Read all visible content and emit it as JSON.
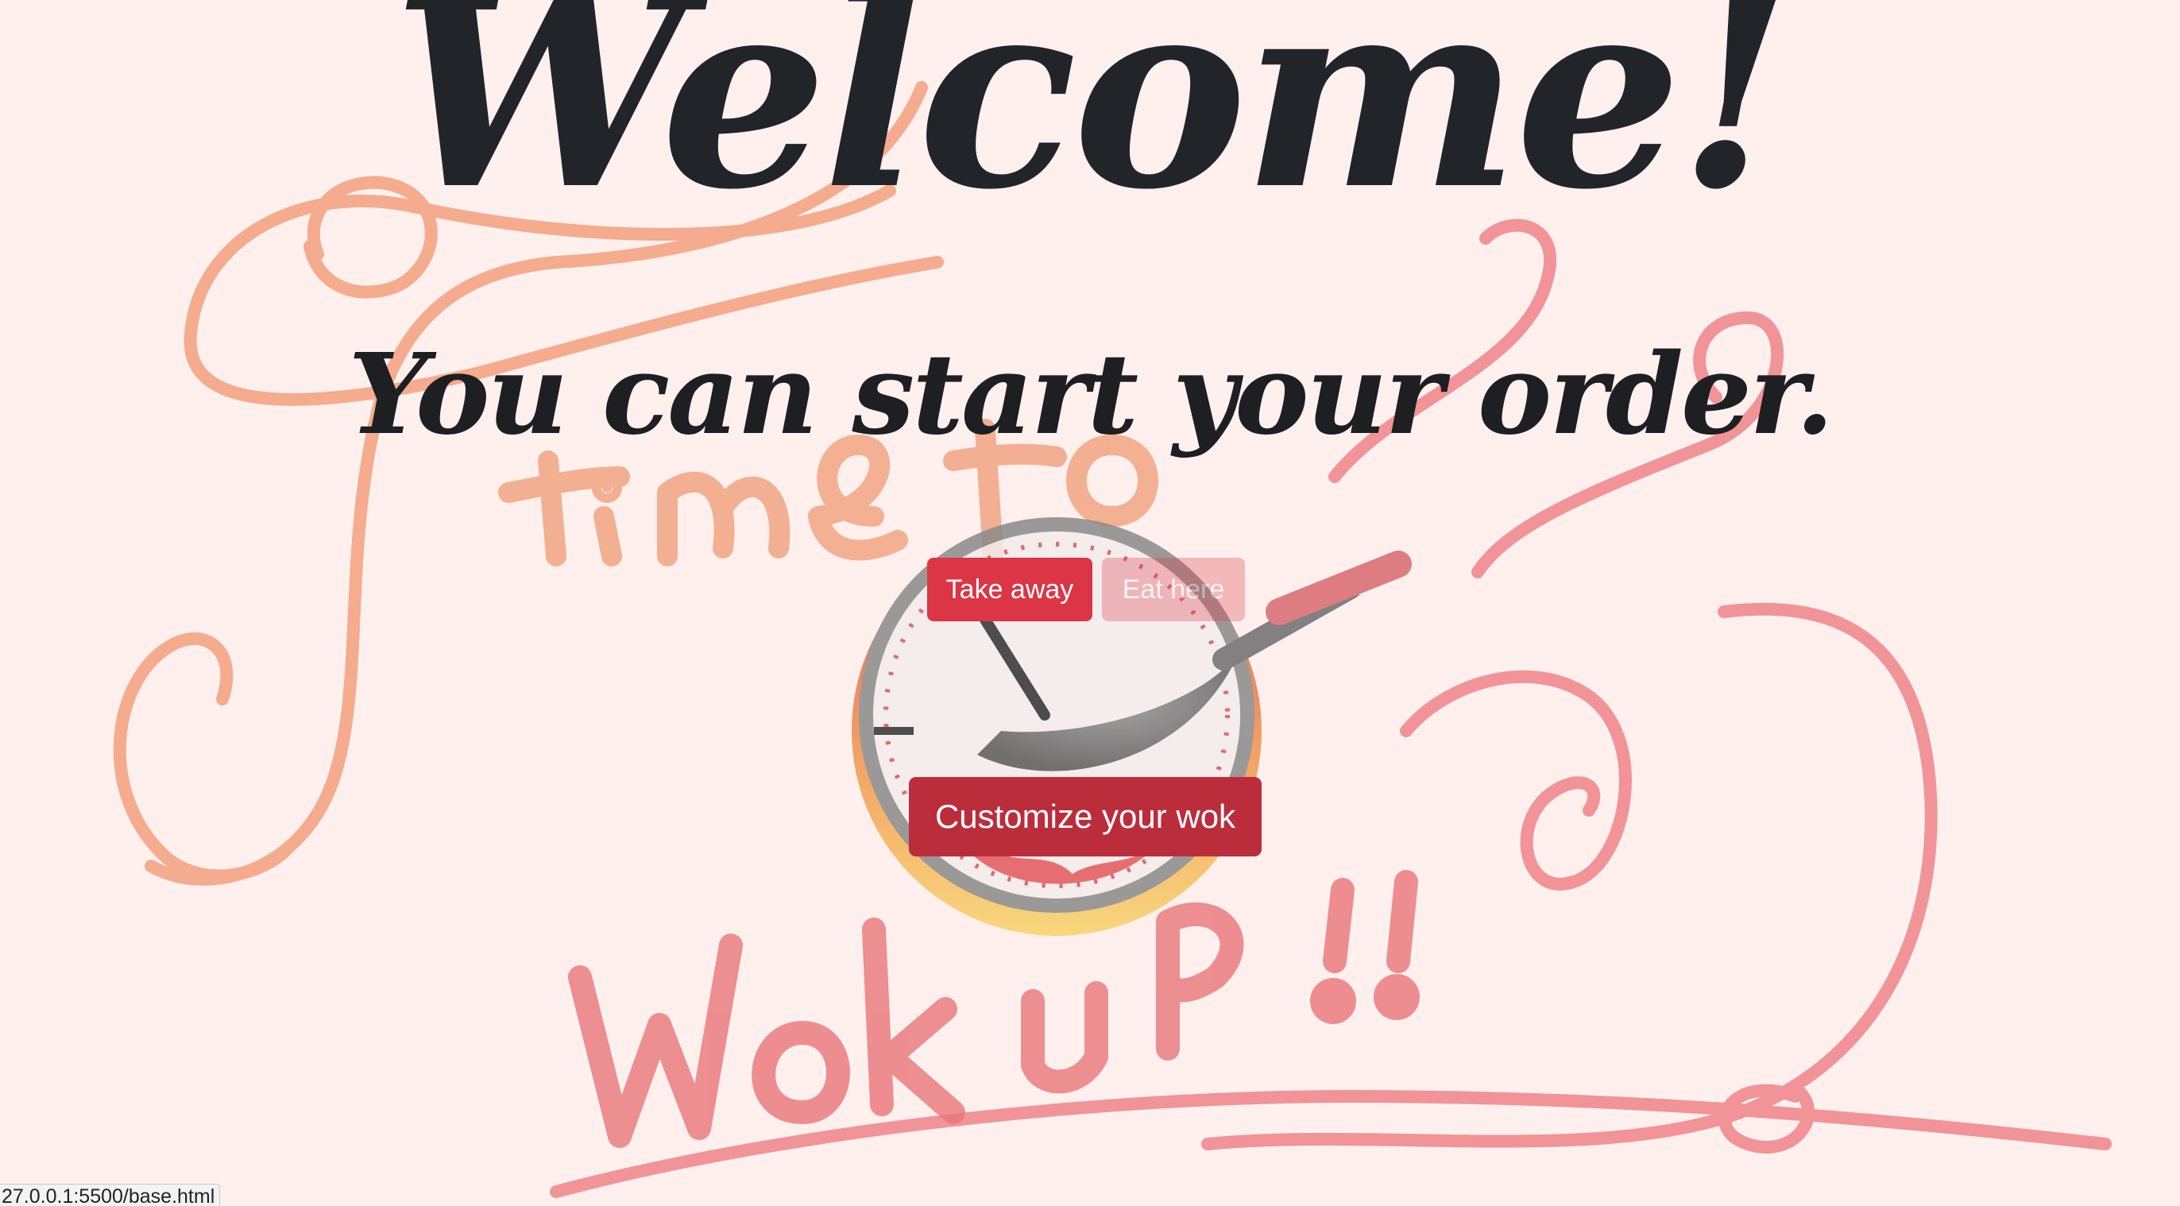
{
  "main": {
    "title": "Welcome!",
    "subtitle": "You can start your order."
  },
  "order_options": {
    "take_away_label": "Take away",
    "eat_here_label": "Eat here"
  },
  "customize_label": "Customize your wok",
  "status_bar": {
    "url": "27.0.0.1:5500/base.html"
  },
  "colors": {
    "background": "#fff0ee",
    "button_primary": "#dc3545",
    "button_dark": "#bb2d3b",
    "swirl_orange": "#f4a07e",
    "swirl_pink": "#f08a8e"
  },
  "icons": {
    "logo": "wok-clock-logo-icon"
  }
}
